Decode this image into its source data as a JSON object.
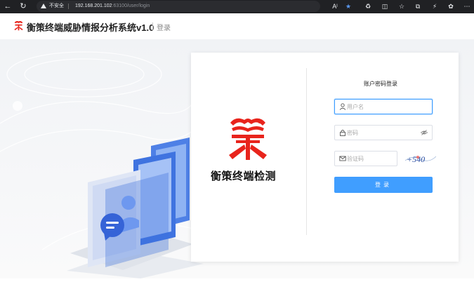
{
  "browser": {
    "security_label": "不安全",
    "url_host": "192.168.201.102",
    "url_path": ":6310​0/user/login"
  },
  "header": {
    "title": "衡策终端威胁情报分析系统v1.0",
    "login_link": "登录"
  },
  "brand": {
    "name": "衡策终端检测"
  },
  "form": {
    "title": "账户密码登录",
    "username_placeholder": "用户名",
    "password_placeholder": "密码",
    "captcha_placeholder": "验证码",
    "captcha_text": "+540",
    "submit_label": "登录"
  },
  "colors": {
    "accent": "#409eff",
    "logo_red": "#e8241c",
    "browser_bg": "#202124"
  },
  "icons": [
    "back-icon",
    "refresh-icon",
    "warning-icon",
    "read-aloud-icon",
    "favorite-star-icon",
    "extensions-icon",
    "split-screen-icon",
    "favorites-icon",
    "collections-icon",
    "performance-icon",
    "copilot-icon",
    "more-icon",
    "user-icon",
    "lock-icon",
    "eye-off-icon",
    "mail-icon"
  ]
}
